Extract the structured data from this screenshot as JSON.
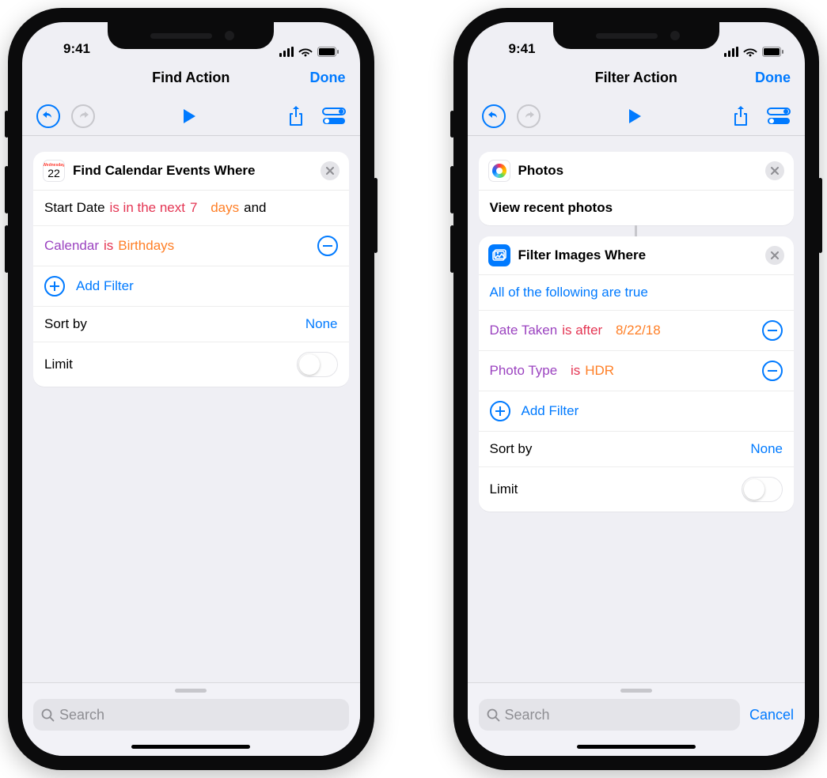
{
  "status": {
    "time": "9:41"
  },
  "left": {
    "nav": {
      "title": "Find Action",
      "done": "Done"
    },
    "card": {
      "title": "Find Calendar Events Where",
      "cal_day_word": "Wednesday",
      "cal_day_num": "22",
      "row1": {
        "prefix": "Start Date",
        "op": "is in the next",
        "num": "7",
        "unit": "days",
        "suffix": "and"
      },
      "row2": {
        "field": "Calendar",
        "op": "is",
        "value": "Birthdays"
      },
      "add_filter": "Add Filter",
      "sort_label": "Sort by",
      "sort_value": "None",
      "limit_label": "Limit"
    },
    "search_placeholder": "Search"
  },
  "right": {
    "nav": {
      "title": "Filter Action",
      "done": "Done"
    },
    "photos_card": {
      "title": "Photos",
      "sub": "View recent photos"
    },
    "filter_card": {
      "title": "Filter Images Where",
      "all_true": "All of the following are true",
      "row1": {
        "field": "Date Taken",
        "op": "is after",
        "value": "8/22/18"
      },
      "row2": {
        "field": "Photo Type",
        "op": "is",
        "value": "HDR"
      },
      "add_filter": "Add Filter",
      "sort_label": "Sort by",
      "sort_value": "None",
      "limit_label": "Limit"
    },
    "search_placeholder": "Search",
    "cancel": "Cancel"
  }
}
